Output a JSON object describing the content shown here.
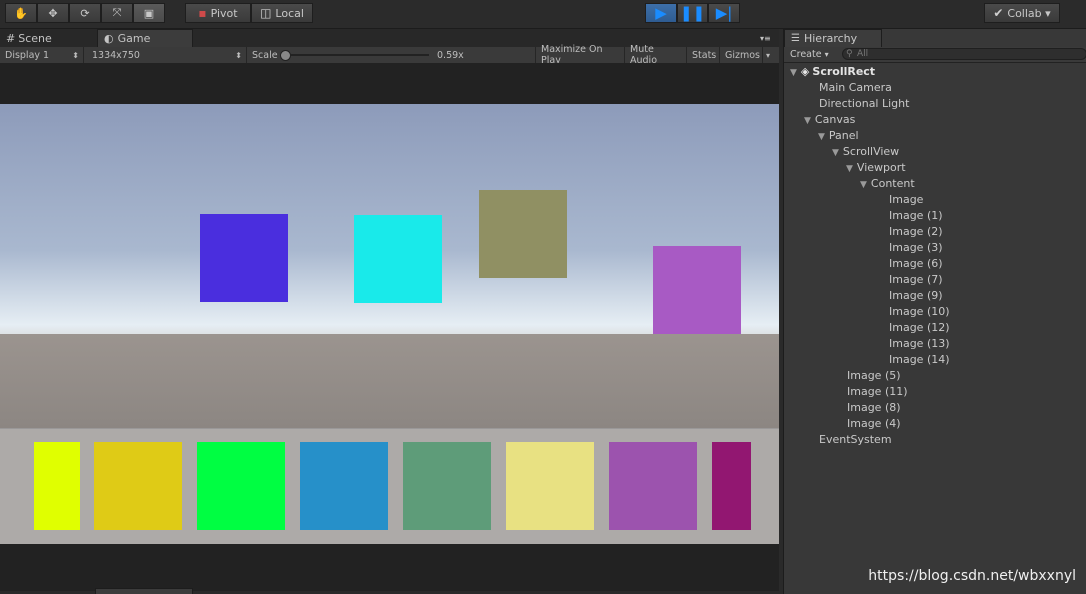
{
  "toolbar": {
    "pivot_label": "Pivot",
    "local_label": "Local",
    "collab_label": "Collab",
    "collab_caret": "▾"
  },
  "tabs": {
    "scene": "Scene",
    "game": "Game",
    "menu": "▾≡"
  },
  "gamebar": {
    "display": "Display 1",
    "resolution": "1334x750",
    "scale_label": "Scale",
    "scale_value": "0.59x",
    "maximize": "Maximize On Play",
    "mute": "Mute Audio",
    "stats": "Stats",
    "gizmos": "Gizmos",
    "gizmos_caret": "▾",
    "spinner": "⬍"
  },
  "hierarchy": {
    "tab": "Hierarchy",
    "create": "Create",
    "search_placeholder": "All",
    "rows": [
      {
        "label": "ScrollRect",
        "level": 0,
        "expanded": true,
        "bold": true
      },
      {
        "label": "Main Camera",
        "level": 1
      },
      {
        "label": "Directional Light",
        "level": 1
      },
      {
        "label": "Canvas",
        "level": 1,
        "expanded": true
      },
      {
        "label": "Panel",
        "level": 2,
        "expanded": true
      },
      {
        "label": "ScrollView",
        "level": 3,
        "expanded": true
      },
      {
        "label": "Viewport",
        "level": 4,
        "expanded": true
      },
      {
        "label": "Content",
        "level": 5,
        "expanded": true
      },
      {
        "label": "Image",
        "level": 6
      },
      {
        "label": "Image (1)",
        "level": 6
      },
      {
        "label": "Image (2)",
        "level": 6
      },
      {
        "label": "Image (3)",
        "level": 6
      },
      {
        "label": "Image (6)",
        "level": 6
      },
      {
        "label": "Image (7)",
        "level": 6
      },
      {
        "label": "Image (9)",
        "level": 6
      },
      {
        "label": "Image (10)",
        "level": 6
      },
      {
        "label": "Image (12)",
        "level": 6
      },
      {
        "label": "Image (13)",
        "level": 6
      },
      {
        "label": "Image (14)",
        "level": 6
      },
      {
        "label": "Image (5)",
        "level": 3
      },
      {
        "label": "Image (11)",
        "level": 3
      },
      {
        "label": "Image (8)",
        "level": 3
      },
      {
        "label": "Image (4)",
        "level": 3
      },
      {
        "label": "EventSystem",
        "level": 1
      }
    ]
  },
  "scene_squares": [
    "#4a2ede",
    "#19eaea",
    "#909063",
    "#a85ac4"
  ],
  "panel_squares": [
    "#e0ff00",
    "#dfcb16",
    "#00fe42",
    "#2690c9",
    "#5e9c79",
    "#e8e182",
    "#9c53ae",
    "#921771"
  ],
  "watermark": "https://blog.csdn.net/wbxxnyl"
}
